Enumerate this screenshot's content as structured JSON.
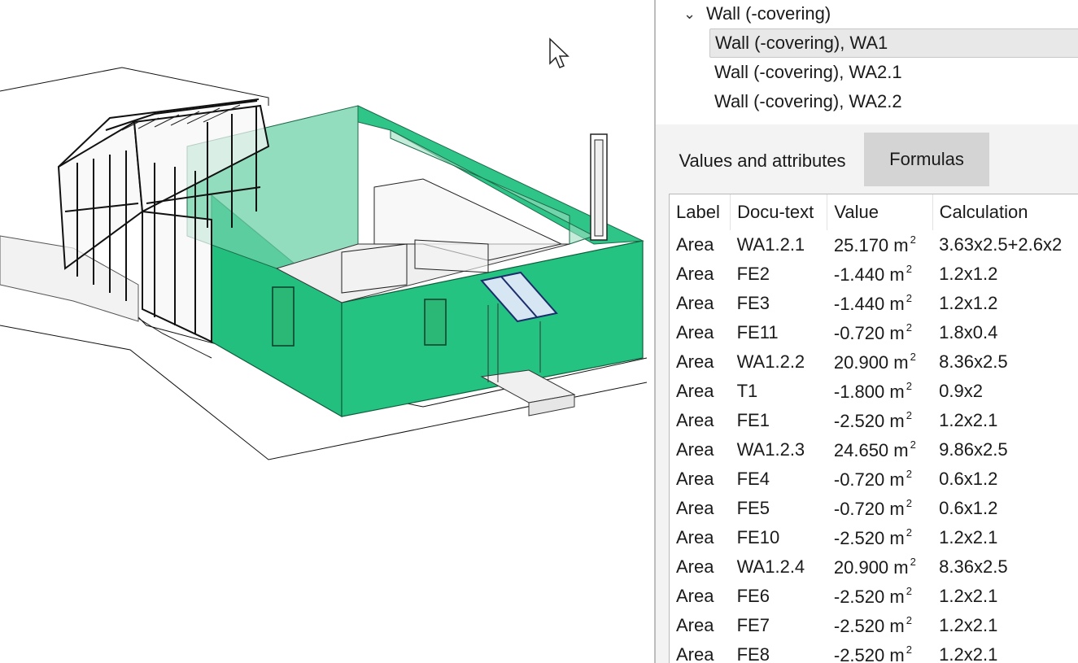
{
  "tree": {
    "parent": {
      "label": "Wall (-covering)",
      "icon": "chevron-down-icon"
    },
    "children": [
      {
        "label": "Wall (-covering), WA1",
        "selected": true
      },
      {
        "label": "Wall (-covering), WA2.1",
        "selected": false
      },
      {
        "label": "Wall (-covering), WA2.2",
        "selected": false
      }
    ]
  },
  "tabs": {
    "values": "Values and attributes",
    "formulas": "Formulas",
    "active": "formulas"
  },
  "grid": {
    "headers": {
      "label": "Label",
      "doc": "Docu-text",
      "value": "Value",
      "calc": "Calculation"
    },
    "unit": "m",
    "unit_exp": "2",
    "rows": [
      {
        "label": "Area",
        "doc": "WA1.2.1",
        "value": "25.170",
        "calc": "3.63x2.5+2.6x2"
      },
      {
        "label": "Area",
        "doc": "FE2",
        "value": "-1.440",
        "calc": "1.2x1.2"
      },
      {
        "label": "Area",
        "doc": "FE3",
        "value": "-1.440",
        "calc": "1.2x1.2"
      },
      {
        "label": "Area",
        "doc": "FE11",
        "value": "-0.720",
        "calc": "1.8x0.4"
      },
      {
        "label": "Area",
        "doc": "WA1.2.2",
        "value": "20.900",
        "calc": "8.36x2.5"
      },
      {
        "label": "Area",
        "doc": "T1",
        "value": "-1.800",
        "calc": "0.9x2"
      },
      {
        "label": "Area",
        "doc": "FE1",
        "value": "-2.520",
        "calc": "1.2x2.1"
      },
      {
        "label": "Area",
        "doc": "WA1.2.3",
        "value": "24.650",
        "calc": "9.86x2.5"
      },
      {
        "label": "Area",
        "doc": "FE4",
        "value": "-0.720",
        "calc": "0.6x1.2"
      },
      {
        "label": "Area",
        "doc": "FE5",
        "value": "-0.720",
        "calc": "0.6x1.2"
      },
      {
        "label": "Area",
        "doc": "FE10",
        "value": "-2.520",
        "calc": "1.2x2.1"
      },
      {
        "label": "Area",
        "doc": "WA1.2.4",
        "value": "20.900",
        "calc": "8.36x2.5"
      },
      {
        "label": "Area",
        "doc": "FE6",
        "value": "-2.520",
        "calc": "1.2x2.1"
      },
      {
        "label": "Area",
        "doc": "FE7",
        "value": "-2.520",
        "calc": "1.2x2.1"
      },
      {
        "label": "Area",
        "doc": "FE8",
        "value": "-2.520",
        "calc": "1.2x2.1"
      }
    ]
  },
  "colors": {
    "wall_highlight": "#22c07d",
    "wall_dark": "#1aa56a",
    "panel_bg": "#f3f3f3",
    "tab_active": "#d4d4d4"
  }
}
